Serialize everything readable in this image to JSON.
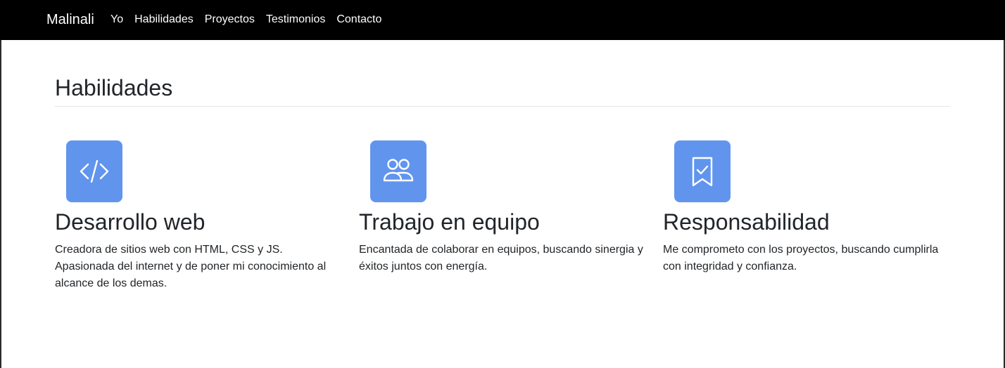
{
  "navbar": {
    "brand": "Malinali",
    "links": [
      "Yo",
      "Habilidades",
      "Proyectos",
      "Testimonios",
      "Contacto"
    ]
  },
  "section": {
    "title": "Habilidades"
  },
  "features": [
    {
      "icon": "code-icon",
      "title": "Desarrollo web",
      "text": "Creadora de sitios web con HTML, CSS y JS. Apasionada del internet y de poner mi conocimiento al alcance de los demas."
    },
    {
      "icon": "people-icon",
      "title": "Trabajo en equipo",
      "text": "Encantada de colaborar en equipos, buscando sinergia y éxitos juntos con energía."
    },
    {
      "icon": "bookmark-check-icon",
      "title": "Responsabilidad",
      "text": "Me comprometo con los proyectos, buscando cumplirla con integridad y confianza."
    }
  ],
  "colors": {
    "navbar_bg": "#000000",
    "icon_bg": "#6195ed",
    "text": "#212529",
    "divider": "#e3e5e8"
  }
}
